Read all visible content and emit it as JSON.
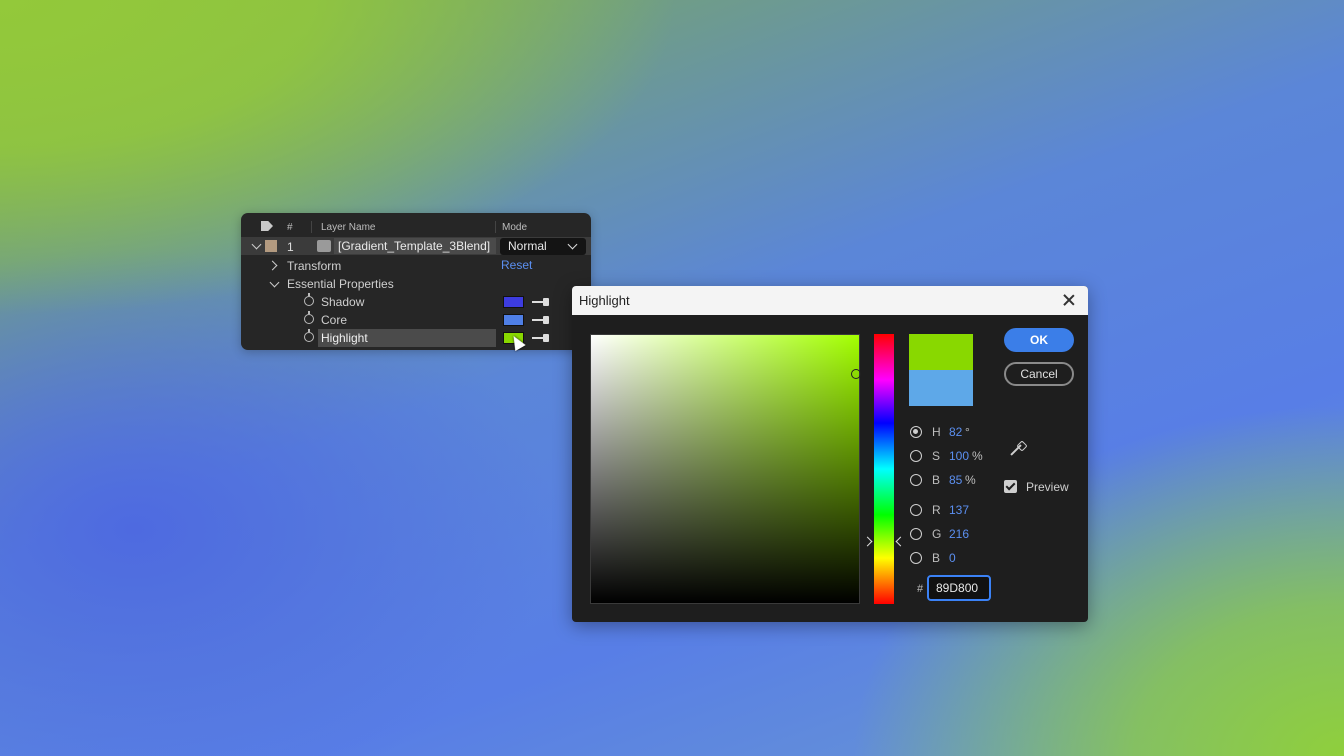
{
  "layer_panel": {
    "header": {
      "num": "#",
      "layer_name": "Layer Name",
      "mode": "Mode"
    },
    "layer": {
      "number": "1",
      "name": "[Gradient_Template_3Blend]",
      "mode": "Normal"
    },
    "transform": {
      "label": "Transform",
      "reset": "Reset"
    },
    "essential": {
      "label": "Essential Properties"
    },
    "properties": [
      {
        "name": "Shadow",
        "color": "#3d3ce0"
      },
      {
        "name": "Core",
        "color": "#4f7fe6"
      },
      {
        "name": "Highlight",
        "color": "#89d800"
      }
    ]
  },
  "dialog": {
    "title": "Highlight",
    "ok": "OK",
    "cancel": "Cancel",
    "preview": "Preview",
    "new_color": "#89d800",
    "old_color": "#5ea8e8",
    "fields": {
      "h": {
        "letter": "H",
        "value": "82",
        "unit": "°"
      },
      "s": {
        "letter": "S",
        "value": "100",
        "unit": "%"
      },
      "b": {
        "letter": "B",
        "value": "85",
        "unit": "%"
      },
      "r": {
        "letter": "R",
        "value": "137"
      },
      "g": {
        "letter": "G",
        "value": "216"
      },
      "b2": {
        "letter": "B",
        "value": "0"
      }
    },
    "hash": "#",
    "hex": "89D800"
  },
  "icons": {
    "tag": "label-tag-icon",
    "stopwatch": "stopwatch-icon",
    "eyedropper": "eyedropper-icon",
    "close": "close-icon"
  }
}
